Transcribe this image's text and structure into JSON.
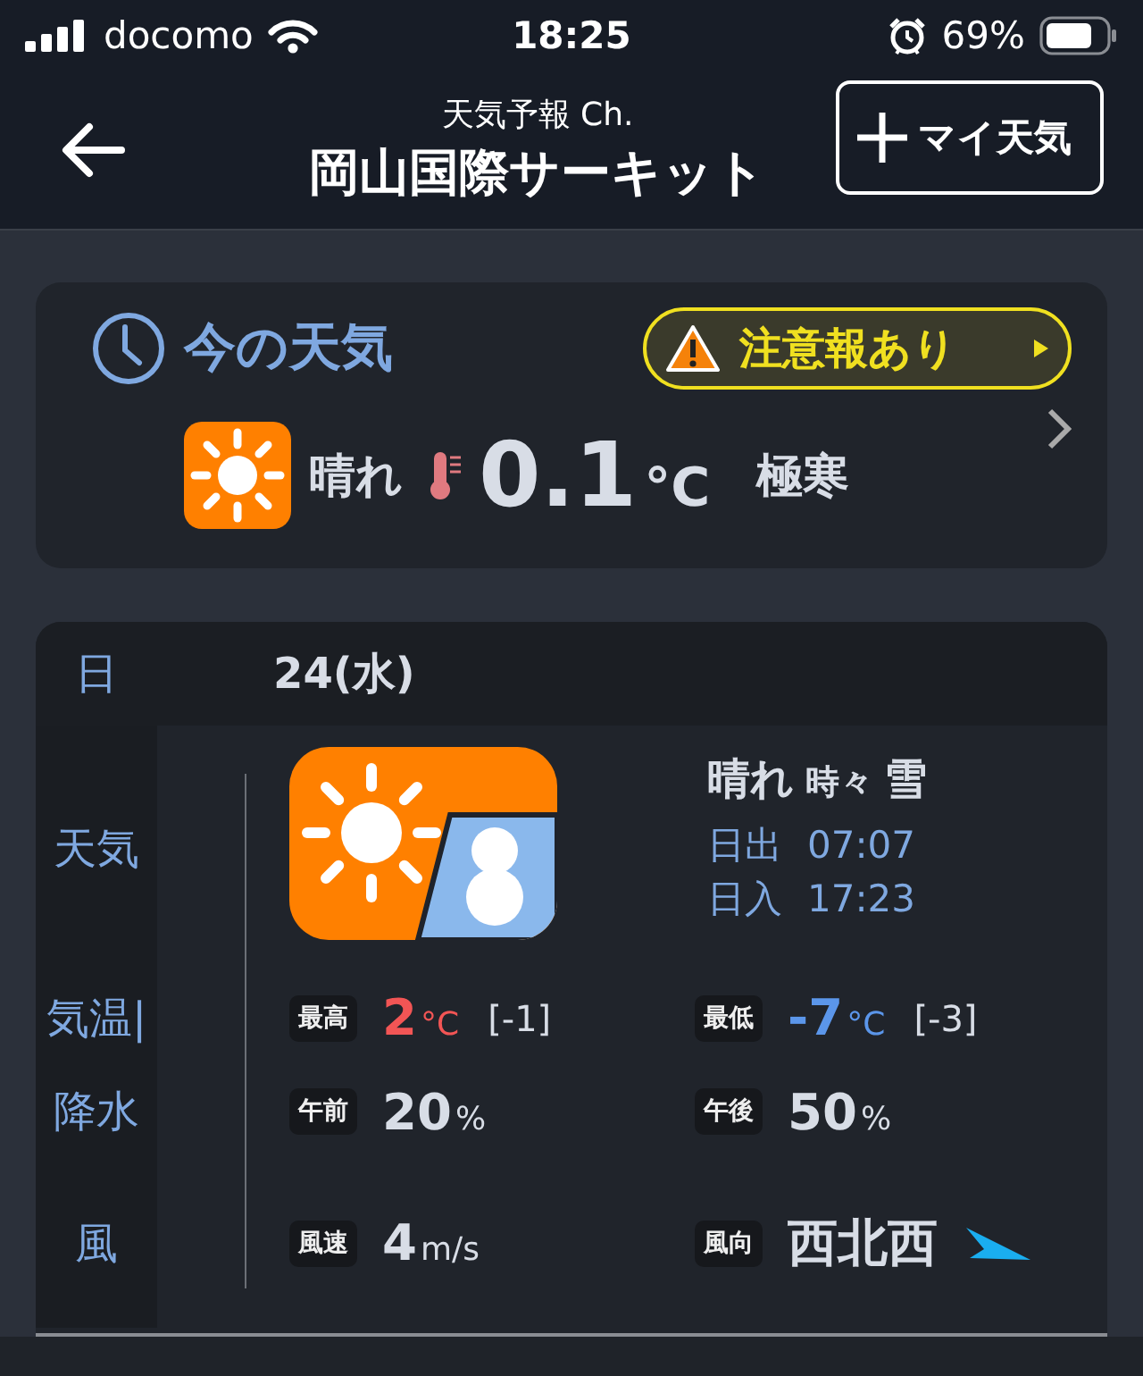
{
  "status_bar": {
    "carrier": "docomo",
    "time": "18:25",
    "battery": "69%"
  },
  "nav": {
    "subtitle": "天気予報 Ch.",
    "title": "岡山国際サーキット",
    "add_button": "マイ天気"
  },
  "current": {
    "title": "今の天気",
    "alert": "注意報あり",
    "weather": "晴れ",
    "temperature": "0.1",
    "unit": "°C",
    "feeling": "極寒"
  },
  "forecast": {
    "day_label": "日",
    "date": "24(水)",
    "row_labels": [
      "天気",
      "気温|",
      "降水",
      "風"
    ],
    "weather": {
      "main": "晴れ",
      "connector": "時々",
      "secondary": "雪"
    },
    "sun": [
      {
        "label": "日出",
        "time": "07:07"
      },
      {
        "label": "日入",
        "time": "17:23"
      }
    ],
    "temperatures": [
      {
        "kind": "high",
        "tag": "最高",
        "value": "2",
        "unit": "°C",
        "diff": "[-1]"
      },
      {
        "kind": "low",
        "tag": "最低",
        "value": "-7",
        "unit": "°C",
        "diff": "[-3]"
      }
    ],
    "precipitation": [
      {
        "tag": "午前",
        "value": "20",
        "unit": "%"
      },
      {
        "tag": "午後",
        "value": "50",
        "unit": "%"
      }
    ],
    "wind": {
      "speed_tag": "風速",
      "speed": "4",
      "speed_unit": "m/s",
      "direction_tag": "風向",
      "direction": "西北西"
    }
  }
}
